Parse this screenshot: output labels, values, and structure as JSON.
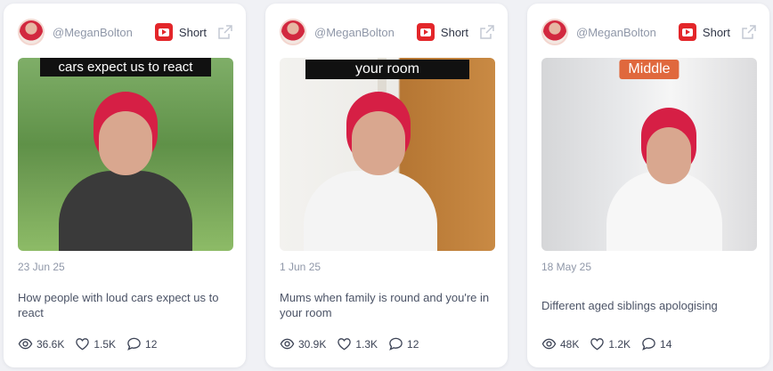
{
  "cards": [
    {
      "author": "@MeganBolton",
      "type_label": "Short",
      "platform_icon": "youtube-icon",
      "thumbnail_caption": "cars expect us to react",
      "date": "23 Jun 25",
      "description": "How people with loud cars expect us to react",
      "views": "36.6K",
      "likes": "1.5K",
      "comments": "12"
    },
    {
      "author": "@MeganBolton",
      "type_label": "Short",
      "platform_icon": "youtube-icon",
      "thumbnail_caption": "your room",
      "date": "1 Jun 25",
      "description": "Mums when family is round and you're in your room",
      "views": "30.9K",
      "likes": "1.3K",
      "comments": "12"
    },
    {
      "author": "@MeganBolton",
      "type_label": "Short",
      "platform_icon": "youtube-icon",
      "thumbnail_caption": "Middle",
      "date": "18 May 25",
      "description": "Different aged siblings apologising",
      "views": "48K",
      "likes": "1.2K",
      "comments": "14"
    }
  ],
  "colors": {
    "youtube_red": "#e3262a",
    "caption_orange": "#e0683d",
    "muted_text": "#8f97a8",
    "card_background": "#ffffff",
    "page_background": "#f0f1f5"
  },
  "icons": {
    "external": "external-link-icon",
    "views": "eye-icon",
    "likes": "heart-icon",
    "comments": "comment-icon"
  }
}
